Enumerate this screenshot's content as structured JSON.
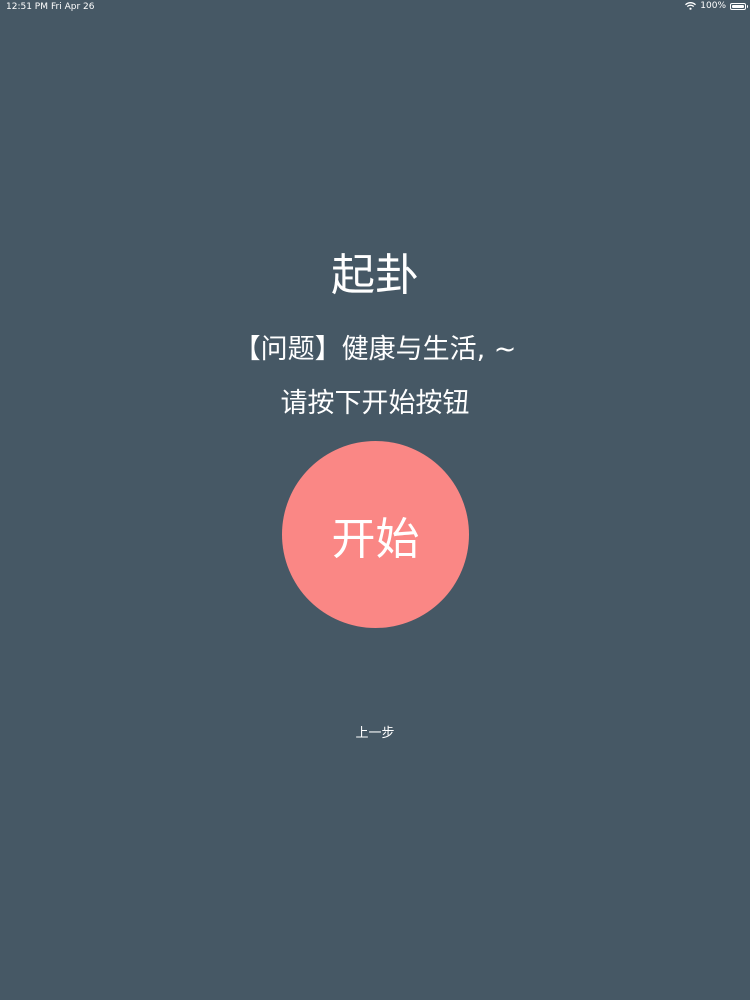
{
  "status_bar": {
    "time": "12:51 PM",
    "date": "Fri Apr 26",
    "battery": "100%",
    "icons": [
      "wifi-icon",
      "battery-icon"
    ]
  },
  "main": {
    "title": "起卦",
    "question": "【问题】健康与生活, ~",
    "instruction": "请按下开始按钮",
    "start_label": "开始",
    "back_label": "上一步"
  },
  "colors": {
    "background": "#465865",
    "button": "#fa8785",
    "text": "#ffffff"
  }
}
